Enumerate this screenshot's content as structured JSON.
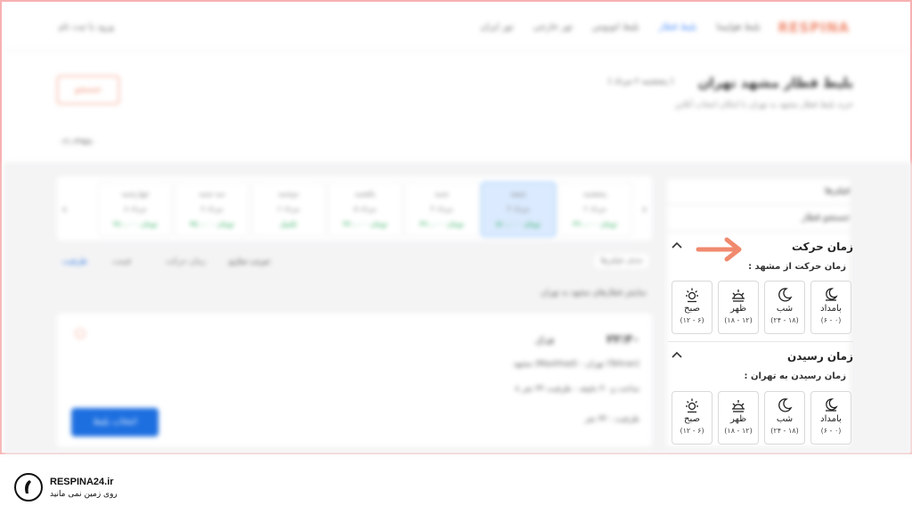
{
  "header": {
    "logo": "RESPINA",
    "nav": [
      "بلیط هواپیما",
      "بلیط قطار",
      "بلیط اتوبوس",
      "تور خارجی",
      "تور ایران"
    ],
    "login": "ورود یا ثبت نام"
  },
  "title": {
    "page_title": "بلیط قطار مشهد تهران",
    "date_chip": "( پنجشنبه ۲ مرداد )",
    "subtitle": "خرید بلیط قطار مشهد به تهران با امکان انتخاب آنلاین",
    "search_label": "جستجو",
    "phone": "۰۲۱-۴۹۵۸۰"
  },
  "days": [
    {
      "day": "پنجشنبه",
      "date": "۲ مرداد",
      "price": "۴۹۰,۰۰۰ تومان"
    },
    {
      "day": "جمعه",
      "date": "۳ مرداد",
      "price": "۵۱۰,۰۰۰ تومان"
    },
    {
      "day": "شنبه",
      "date": "۴ مرداد",
      "price": "۴۹۰,۰۰۰ تومان"
    },
    {
      "day": "یکشنبه",
      "date": "۵ مرداد",
      "price": "۴۷۰,۰۰۰ تومان"
    },
    {
      "day": "دوشنبه",
      "date": "۶ مرداد",
      "price": "تکمیل"
    },
    {
      "day": "سه شنبه",
      "date": "۷ مرداد",
      "price": "۴۵۰,۰۰۰ تومان"
    },
    {
      "day": "چهارشنبه",
      "date": "۸ مرداد",
      "price": "۴۸۰,۰۰۰ تومان"
    }
  ],
  "sort": {
    "label": "مرتب سازی:",
    "options": [
      "زمان حرکت",
      "قیمت",
      "ظرفیت"
    ],
    "filter_chip": "حذف فیلترها"
  },
  "note": "نمایش قطارهای مشهد به تهران",
  "trip": {
    "time": "۲۲:۳۰",
    "train": "فدک",
    "route": "مشهد (Mashhad) - تهران (Tehran)",
    "info": "۸ ساعت و ۴۰ دقیقه - ظرفیت ۳۴ نفر",
    "capacity": "ظرفیت : ۳۴ نفر",
    "buy_label": "انتخاب بلیط"
  },
  "filters": {
    "heading": "فیلترها",
    "train_search": "جستجو قطار"
  },
  "departure": {
    "title": "زمان حرکت",
    "subtitle": "زمان حرکت از مشهد :",
    "slots": [
      {
        "label": "بامداد",
        "range": "(۰ - ۶)",
        "icon": "moon-icon"
      },
      {
        "label": "شب",
        "range": "(۱۸ - ۲۴)",
        "icon": "crescent-icon"
      },
      {
        "label": "ظهر",
        "range": "(۱۲ - ۱۸)",
        "icon": "sunset-icon"
      },
      {
        "label": "صبح",
        "range": "(۶ - ۱۲)",
        "icon": "sun-icon"
      }
    ]
  },
  "arrival": {
    "title": "زمان رسیدن",
    "subtitle": "زمان رسیدن به تهران :",
    "slots": [
      {
        "label": "بامداد",
        "range": "(۰ - ۶)",
        "icon": "moon-icon"
      },
      {
        "label": "شب",
        "range": "(۱۸ - ۲۴)",
        "icon": "crescent-icon"
      },
      {
        "label": "ظهر",
        "range": "(۱۲ - ۱۸)",
        "icon": "sunset-icon"
      },
      {
        "label": "صبح",
        "range": "(۶ - ۱۲)",
        "icon": "sun-icon"
      }
    ]
  },
  "brand": {
    "name": "RESPINA24.ir",
    "tagline": "روی زمین نمی مانید"
  },
  "colors": {
    "accent_orange": "#f08a6e",
    "primary_blue": "#1d6fe0",
    "frame_border": "#f6b1b1"
  }
}
